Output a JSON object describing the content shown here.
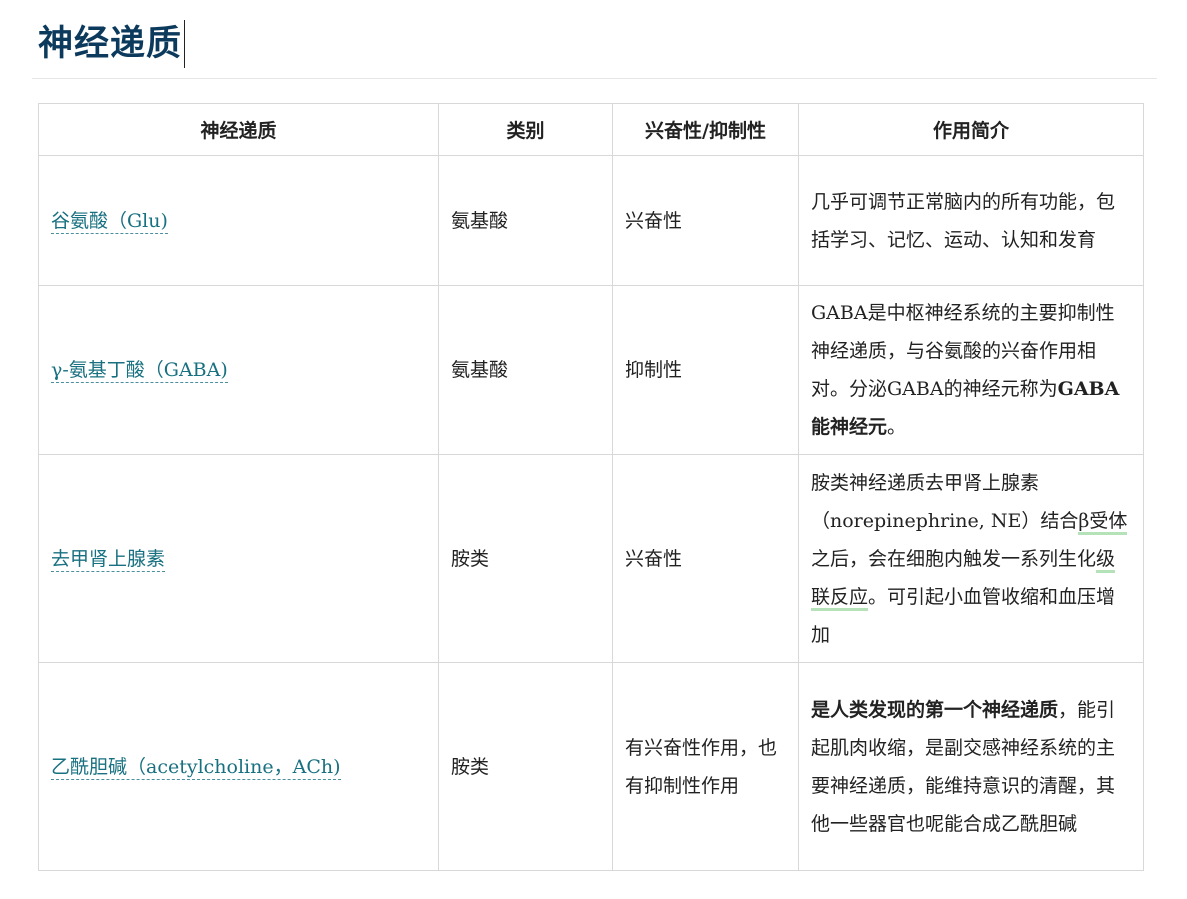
{
  "page": {
    "title": "神经递质"
  },
  "table": {
    "headers": [
      "神经递质",
      "类别",
      "兴奋性/抑制性",
      "作用简介"
    ],
    "rows": [
      {
        "name": "谷氨酸（Glu)",
        "category": "氨基酸",
        "effect": "兴奋性",
        "summary": {
          "text": "几乎可调节正常脑内的所有功能，包括学习、记忆、运动、认知和发育"
        }
      },
      {
        "name": "γ-氨基丁酸（GABA)",
        "category": "氨基酸",
        "effect": "抑制性",
        "summary": {
          "text_before": "GABA是中枢神经系统的主要抑制性神经递质，与谷氨酸的兴奋作用相对。分泌GABA的神经元称为",
          "bold": "GABA能神经元",
          "text_after": "。"
        }
      },
      {
        "name": "去甲肾上腺素",
        "category": "胺类",
        "effect": "兴奋性",
        "summary": {
          "p1": "胺类神经递质去甲肾上腺素（norepinephrine, NE）结合",
          "link1": "β受体",
          "p2": "之后，会在细胞内触发一系列生化",
          "link2": "级联反应",
          "p3": "。可引起小血管收缩和血压增加"
        }
      },
      {
        "name": "乙酰胆碱（acetylcholine，ACh)",
        "category": "胺类",
        "effect": "有兴奋性作用，也有抑制性作用",
        "summary": {
          "bold": "是人类发现的第一个神经递质",
          "text_after": "，能引起肌肉收缩，是副交感神经系统的主要神经递质，能维持意识的清醒，其他一些器官也呢能合成乙酰胆碱"
        }
      }
    ]
  },
  "colors": {
    "title": "#0c3a5c",
    "link": "#187080",
    "highlight": "#b5e2b9",
    "border": "#d8d8d8"
  }
}
